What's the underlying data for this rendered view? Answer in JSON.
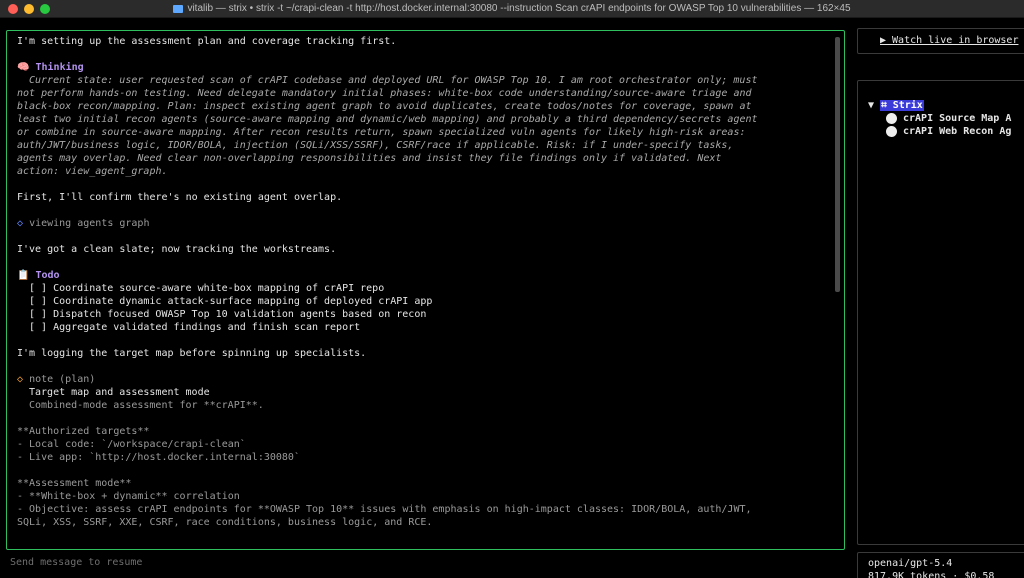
{
  "window": {
    "title": "vitalib — strix • strix -t ~/crapi-clean -t http://host.docker.internal:30080 --instruction Scan crAPI endpoints for OWASP Top 10 vulnerabilities — 162×45"
  },
  "chat": {
    "intro": "I'm setting up the assessment plan and coverage tracking first.",
    "thinking": {
      "label": "Thinking",
      "lines": [
        "Current state: user requested scan of crAPI codebase and deployed URL for OWASP Top 10. I am root orchestrator only; must",
        "not perform hands-on testing. Need delegate mandatory initial phases: white-box code understanding/source-aware triage and",
        "black-box recon/mapping. Plan: inspect existing agent graph to avoid duplicates, create todos/notes for coverage, spawn at",
        "least two initial recon agents (source-aware mapping and dynamic/web mapping) and probably a third dependency/secrets agent",
        "or combine in source-aware mapping. After recon results return, spawn specialized vuln agents for likely high-risk areas:",
        "auth/JWT/business logic, IDOR/BOLA, injection (SQLi/XSS/SSRF), CSRF/race if applicable. Risk: if I under-specify tasks,",
        "agents may overlap. Need clear non-overlapping responsibilities and insist they file findings only if validated. Next",
        "action: view_agent_graph."
      ]
    },
    "confirm": "First, I'll confirm there's no existing agent overlap.",
    "tool_call": "viewing agents graph",
    "clean_slate": "I've got a clean slate; now tracking the workstreams.",
    "todo": {
      "label": "Todo",
      "items": [
        "[ ] Coordinate source-aware white-box mapping of crAPI repo",
        "[ ] Coordinate dynamic attack-surface mapping of deployed crAPI app",
        "[ ] Dispatch focused OWASP Top 10 validation agents based on recon",
        "[ ] Aggregate validated findings and finish scan report"
      ]
    },
    "logging": "I'm logging the target map before spinning up specialists.",
    "note": {
      "header": "note (plan)",
      "title": "Target map and assessment mode",
      "subtitle": "Combined-mode assessment for **crAPI**.",
      "targets_header": "**Authorized targets**",
      "targets": [
        "- Local code: `/workspace/crapi-clean`",
        "- Live app: `http://host.docker.internal:30080`"
      ],
      "mode_header": "**Assessment mode**",
      "mode_lines": [
        "- **White-box + dynamic** correlation",
        "- Objective: assess crAPI endpoints for **OWASP Top 10** issues with emphasis on high-impact classes: IDOR/BOLA, auth/JWT,",
        "SQLi, XSS, SSRF, XXE, CSRF, race conditions, business logic, and RCE."
      ]
    }
  },
  "input": {
    "placeholder": "Send message to resume"
  },
  "sidebar": {
    "watch_label": "▶ Watch live in browser",
    "tree": {
      "root": "Strix",
      "children": [
        "crAPI Source Map A",
        "crAPI Web Recon Ag"
      ]
    },
    "model": "openai/gpt-5.4",
    "usage": "817.9K tokens · $0.58"
  },
  "colors": {
    "border_active": "#2fbf5f",
    "thinking": "#b392f0",
    "tool": "#5f87ff",
    "note": "#f0a030"
  }
}
